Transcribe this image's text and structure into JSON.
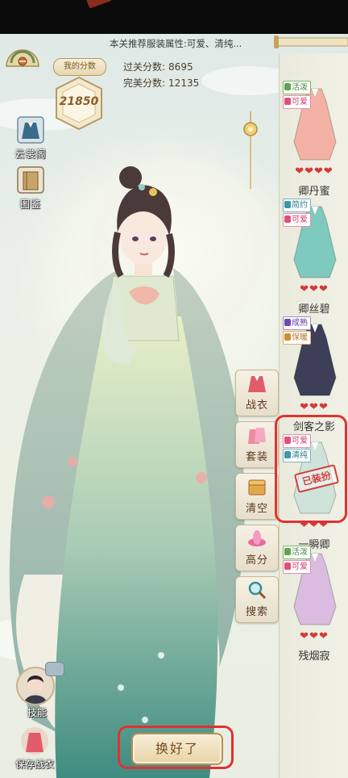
{
  "header": {
    "recommendation": "本关推荐服装属性:可爱、清纯...",
    "my_score_label": "我的分数",
    "my_score": "21850",
    "pass_score_label": "过关分数:",
    "pass_score": "8695",
    "perfect_score_label": "完美分数:",
    "perfect_score": "12135"
  },
  "left_menu": [
    {
      "label": "云裳阁",
      "icon": "robe-icon"
    },
    {
      "label": "图鉴",
      "icon": "book-icon"
    }
  ],
  "actions": [
    {
      "label": "战衣",
      "icon": "battle-robe-icon"
    },
    {
      "label": "套装",
      "icon": "outfit-set-icon"
    },
    {
      "label": "清空",
      "icon": "chest-icon"
    },
    {
      "label": "高分",
      "icon": "lotus-icon"
    },
    {
      "label": "搜索",
      "icon": "search-icon"
    }
  ],
  "wardrobe": [
    {
      "name": "卿丹蜜",
      "tags": [
        {
          "text": "活泼",
          "color": "green"
        },
        {
          "text": "可爱",
          "color": "pink"
        }
      ],
      "hearts": "❤❤❤❤",
      "robe_color": "#f3b2a4",
      "selected": false
    },
    {
      "name": "卿丝碧",
      "tags": [
        {
          "text": "简约",
          "color": "teal"
        },
        {
          "text": "可爱",
          "color": "pink"
        }
      ],
      "hearts": "❤❤❤",
      "robe_color": "#7fcabf",
      "selected": false
    },
    {
      "name": "剑客之影",
      "tags": [
        {
          "text": "成熟",
          "color": "purple"
        },
        {
          "text": "保暖",
          "color": "orange"
        }
      ],
      "hearts": "❤❤❤",
      "robe_color": "#3d3f58",
      "selected": false
    },
    {
      "name": "一瞬卿",
      "tags": [
        {
          "text": "可爱",
          "color": "pink"
        },
        {
          "text": "清纯",
          "color": "teal"
        }
      ],
      "hearts": "❤❤❤",
      "robe_color": "#cfe3da",
      "selected": true,
      "stamp": "已装扮"
    },
    {
      "name": "残烟寂",
      "tags": [
        {
          "text": "活泼",
          "color": "green"
        },
        {
          "text": "可爱",
          "color": "pink"
        }
      ],
      "hearts": "❤❤❤",
      "robe_color": "#d9bce0",
      "selected": false
    }
  ],
  "bottom": {
    "skill_label": "技能",
    "save_label": "保存战衣",
    "confirm_label": "换好了"
  }
}
